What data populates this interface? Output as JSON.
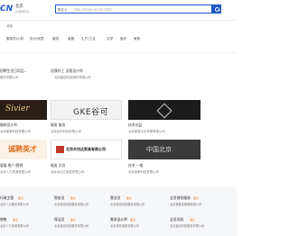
{
  "header": {
    "logo_text": "CN",
    "city": "北京",
    "city_switch": "[切换城市]",
    "search_category": "职位 ▾",
    "search_placeholder": "请输入职位或公司名称/关键字"
  },
  "section_title": "北京",
  "categories": [
    "服务员/小时",
    "设计/创意",
    "服务",
    "客服",
    "生产/工业",
    "文学",
    "医疗",
    "家政"
  ],
  "row1": {
    "left_title": "招聘生活日用品…",
    "left_company": "服务有限公司",
    "mid_label": "设",
    "right_title": "操作工  全客设计师",
    "right_company": "北京鑫信科技服务有限公司"
  },
  "featured": [
    {
      "banner_text": "Sivier",
      "title": "服装设计师",
      "company": "北京某某科技有限公司"
    },
    {
      "banner_text": "GKE谷可",
      "title": "服务  服务",
      "company": "北京谷可科技有限公司"
    },
    {
      "banner_text": "",
      "title": "技术总监",
      "company": "北京某某文化传媒有限公司"
    },
    {
      "banner_text": "诚聘英才",
      "title": "客服  推广/营销",
      "company": "北京人力资源有限公司"
    },
    {
      "banner_text": "北京炎坊达家具有限公司",
      "title": "服务  文员",
      "company": "北京炎坊达家具有限公司"
    },
    {
      "banner_text": "中国北京",
      "title": "技术  一般",
      "company": "北京宜家科技有限公司"
    }
  ],
  "list_rows": [
    [
      {
        "title": "行政主管",
        "tag": "面议",
        "company": "北京人力服务有限公司"
      },
      {
        "title": "财务员",
        "tag": "面议",
        "company": "北京鑫信科技服务有限公司"
      },
      {
        "title": "营业员",
        "tag": "面议",
        "company": "北京鑫信科技服务有限公司"
      },
      {
        "title": "全员餐饮服务",
        "tag": "面议",
        "company": "北京某餐饮管理有限公司"
      }
    ],
    [
      {
        "title": "销售",
        "tag": "面议",
        "company": "北京人力资源有限公司"
      },
      {
        "title": "保洁员",
        "tag": "面议",
        "company": "北京鑫信科技服务有限公司"
      },
      {
        "title": "美发设计师",
        "tag": "面议",
        "company": "北京美发造型有限公司"
      },
      {
        "title": "全员司机",
        "tag": "面议",
        "company": "北京鑫信科技服务有限公司"
      }
    ]
  ],
  "colors": {
    "brand": "#1e56c7",
    "tag": "#e67e22"
  }
}
